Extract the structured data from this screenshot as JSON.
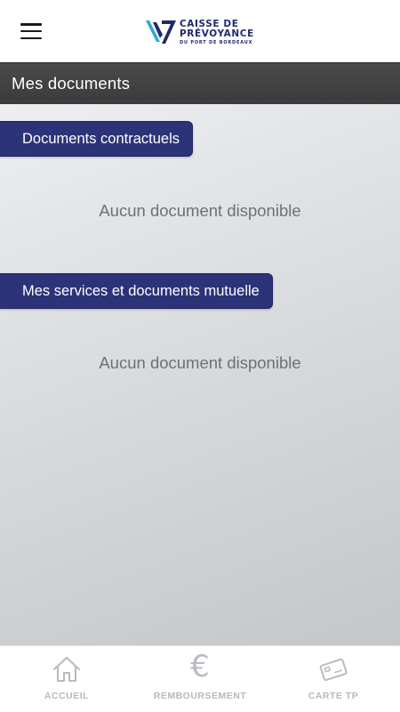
{
  "header": {
    "menu_icon": "hamburger-menu-icon",
    "logo": {
      "line1": "CAISSE DE",
      "line2": "PRÉVOYANCE",
      "line3": "DU PORT DE BORDEAUX",
      "brand_color": "#1f2a6b",
      "accent_color": "#2fa6d6"
    }
  },
  "title_bar": {
    "title": "Mes documents"
  },
  "sections": [
    {
      "label": "Documents contractuels",
      "empty_message": "Aucun document disponible"
    },
    {
      "label": "Mes services et documents mutuelle",
      "empty_message": "Aucun document disponible"
    }
  ],
  "bottom_nav": {
    "items": [
      {
        "label": "ACCUEIL",
        "icon": "home-icon"
      },
      {
        "label": "REMBOURSEMENT",
        "icon": "euro-icon"
      },
      {
        "label": "CARTE TP",
        "icon": "card-icon"
      }
    ]
  },
  "colors": {
    "section_button": "#2c3379",
    "title_bar": "#424242",
    "nav_inactive": "#b5b8bd"
  }
}
